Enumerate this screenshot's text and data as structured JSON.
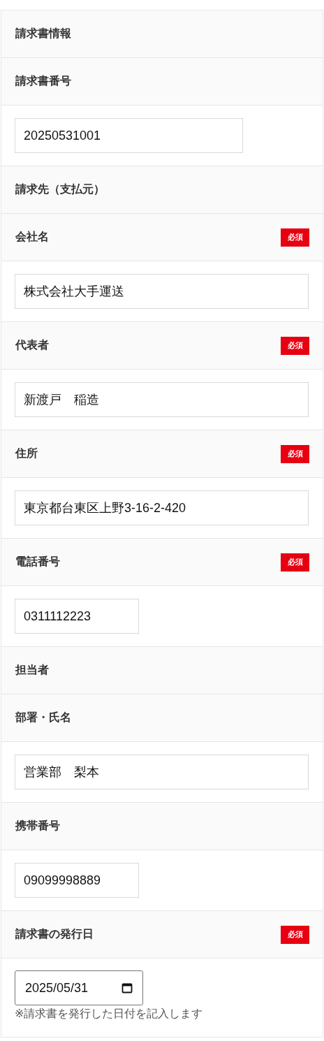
{
  "rows": [
    {
      "kind": "section",
      "label": "請求書情報"
    },
    {
      "kind": "label",
      "label": "請求書番号",
      "required": false
    },
    {
      "kind": "number",
      "value": "20250531001"
    },
    {
      "kind": "section",
      "label": "請求先（支払元）"
    },
    {
      "kind": "label",
      "label": "会社名",
      "required": true,
      "badge": "必須"
    },
    {
      "kind": "text",
      "value": "株式会社大手運送"
    },
    {
      "kind": "label",
      "label": "代表者",
      "required": true,
      "badge": "必須"
    },
    {
      "kind": "text",
      "value": "新渡戸　稲造"
    },
    {
      "kind": "label",
      "label": "住所",
      "required": true,
      "badge": "必須"
    },
    {
      "kind": "text",
      "value": "東京都台東区上野3-16-2-420"
    },
    {
      "kind": "label",
      "label": "電話番号",
      "required": true,
      "badge": "必須"
    },
    {
      "kind": "tel",
      "value": "0311112223"
    },
    {
      "kind": "section",
      "label": "担当者"
    },
    {
      "kind": "label",
      "label": "部署・氏名",
      "required": false
    },
    {
      "kind": "text",
      "value": "営業部　梨本"
    },
    {
      "kind": "label",
      "label": "携帯番号",
      "required": false
    },
    {
      "kind": "tel",
      "value": "09099998889"
    },
    {
      "kind": "label",
      "label": "請求書の発行日",
      "required": true,
      "badge": "必須"
    },
    {
      "kind": "date",
      "value": "2025/05/31",
      "note": "※請求書を発行した日付を記入します"
    }
  ]
}
